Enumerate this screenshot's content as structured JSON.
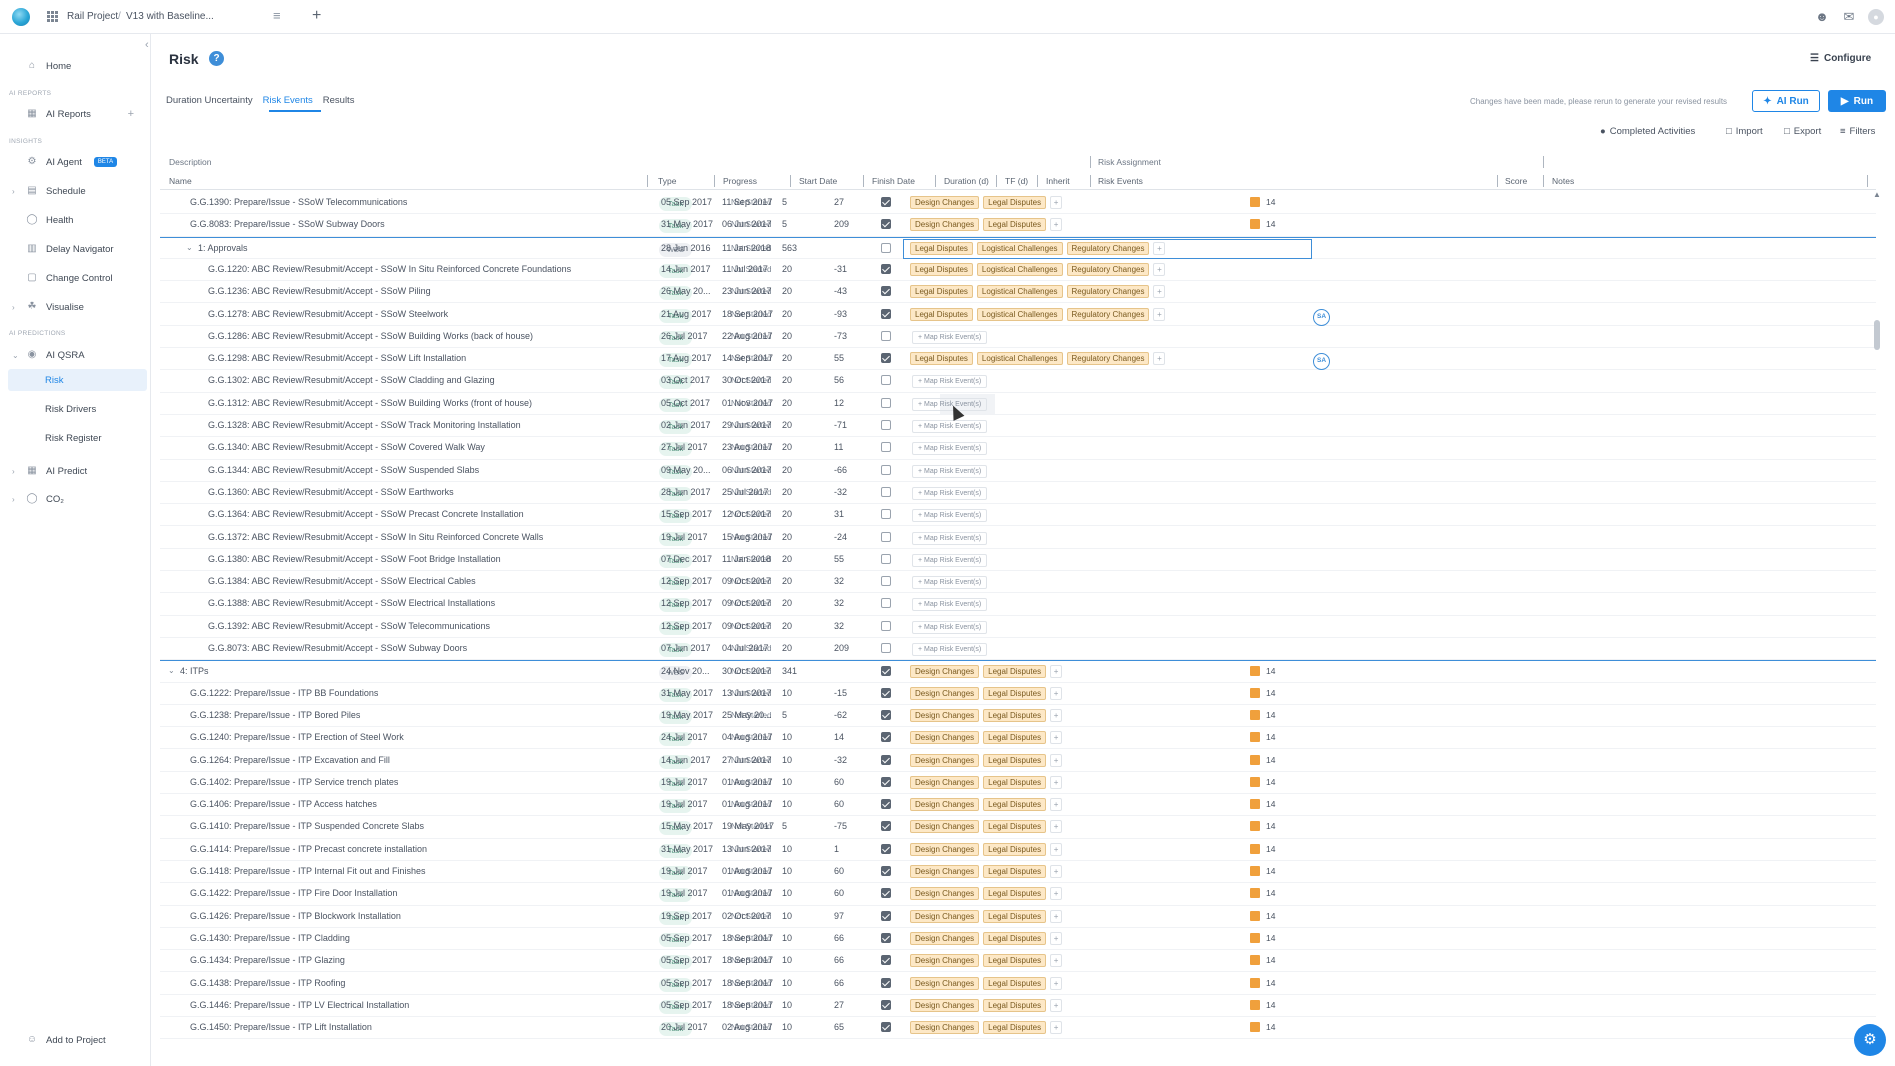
{
  "topbar": {
    "project": "Rail Project",
    "separator": "/",
    "version": "V13 with Baseline...",
    "menu_icon": "≡",
    "add_tab": "+"
  },
  "sidebar": {
    "home": "Home",
    "sec_reports": "AI REPORTS",
    "ai_reports": "AI Reports",
    "sec_insights": "INSIGHTS",
    "ai_agent": "AI Agent",
    "beta": "BETA",
    "schedule": "Schedule",
    "health": "Health",
    "delay_navigator": "Delay Navigator",
    "change_control": "Change Control",
    "visualise": "Visualise",
    "sec_predictions": "AI PREDICTIONS",
    "ai_qsra": "AI QSRA",
    "risk": "Risk",
    "risk_drivers": "Risk Drivers",
    "risk_register": "Risk Register",
    "ai_predict": "AI Predict",
    "co2": "CO₂",
    "add_to_project": "Add to Project"
  },
  "page": {
    "title": "Risk",
    "help": "?",
    "configure": "Configure",
    "tabs": [
      "Duration Uncertainty",
      "Risk Events",
      "Results"
    ],
    "notice": "Changes have been made, please rerun to generate your revised results",
    "ai_run": "AI Run",
    "run": "Run",
    "completed_activities": "Completed Activities",
    "import": "Import",
    "export": "Export",
    "filters": "Filters"
  },
  "grid": {
    "group_description": "Description",
    "group_risk": "Risk Assignment",
    "columns": [
      "Name",
      "Type",
      "Progress",
      "Start Date",
      "Finish Date",
      "Duration (d)",
      "TF (d)",
      "Inherit",
      "Risk Events",
      "Score",
      "Notes"
    ],
    "map_label": "+ Map Risk Event(s)",
    "avatar": "SA",
    "rows": [
      {
        "name": "G.G.1390: Prepare/Issue - SSoW Telecommunications",
        "type": "Task",
        "progress": "Not Started",
        "start": "05 Sep 2017",
        "finish": "11 Sep 2017",
        "dur": "5",
        "tf": "27",
        "inherit": true,
        "tags": [
          "Design Changes",
          "Legal Disputes"
        ],
        "score": "14",
        "indent": 1
      },
      {
        "name": "G.G.8083: Prepare/Issue - SSoW Subway Doors",
        "type": "Task",
        "progress": "Not Started",
        "start": "31 May 2017",
        "finish": "06 Jun 2017",
        "dur": "5",
        "tf": "209",
        "inherit": true,
        "tags": [
          "Design Changes",
          "Legal Disputes"
        ],
        "score": "14",
        "indent": 1
      },
      {
        "name": "1: Approvals",
        "type": "WBS",
        "progress": "Not Started",
        "start": "28 Jun 2016",
        "finish": "11 Jan 2018",
        "dur": "563",
        "tf": "",
        "inherit": false,
        "tags": [
          "Legal Disputes",
          "Logistical Challenges",
          "Regulatory Changes"
        ],
        "score": "",
        "indent": 2,
        "wbs": true,
        "selected": true
      },
      {
        "name": "G.G.1220: ABC Review/Resubmit/Accept - SSoW In Situ Reinforced Concrete Foundations",
        "type": "Task",
        "progress": "Not Started",
        "start": "14 Jun 2017",
        "finish": "11 Jul 2017",
        "dur": "20",
        "tf": "-31",
        "inherit": true,
        "tags": [
          "Legal Disputes",
          "Logistical Challenges",
          "Regulatory Changes"
        ],
        "score": "",
        "indent": 3
      },
      {
        "name": "G.G.1236: ABC Review/Resubmit/Accept - SSoW Piling",
        "type": "Task",
        "progress": "Not Started",
        "start": "26 May 20...",
        "finish": "23 Jun 2017",
        "dur": "20",
        "tf": "-43",
        "inherit": true,
        "tags": [
          "Legal Disputes",
          "Logistical Challenges",
          "Regulatory Changes"
        ],
        "score": "",
        "indent": 3
      },
      {
        "name": "G.G.1278: ABC Review/Resubmit/Accept - SSoW Steelwork",
        "type": "Task",
        "progress": "Not Started",
        "start": "21 Aug 2017",
        "finish": "18 Sep 2017",
        "dur": "20",
        "tf": "-93",
        "inherit": true,
        "tags": [
          "Legal Disputes",
          "Logistical Challenges",
          "Regulatory Changes"
        ],
        "score": "",
        "indent": 3,
        "avatar": true
      },
      {
        "name": "G.G.1286: ABC Review/Resubmit/Accept - SSoW Building Works (back of house)",
        "type": "Task",
        "progress": "Not Started",
        "start": "26 Jul 2017",
        "finish": "22 Aug 2017",
        "dur": "20",
        "tf": "-73",
        "inherit": false,
        "tags": [],
        "score": "",
        "indent": 3
      },
      {
        "name": "G.G.1298: ABC Review/Resubmit/Accept - SSoW Lift Installation",
        "type": "Task",
        "progress": "Not Started",
        "start": "17 Aug 2017",
        "finish": "14 Sep 2017",
        "dur": "20",
        "tf": "55",
        "inherit": true,
        "tags": [
          "Legal Disputes",
          "Logistical Challenges",
          "Regulatory Changes"
        ],
        "score": "",
        "indent": 3,
        "avatar": true
      },
      {
        "name": "G.G.1302: ABC Review/Resubmit/Accept - SSoW Cladding and Glazing",
        "type": "Task",
        "progress": "Not Started",
        "start": "03 Oct 2017",
        "finish": "30 Oct 2017",
        "dur": "20",
        "tf": "56",
        "inherit": false,
        "tags": [],
        "score": "",
        "indent": 3
      },
      {
        "name": "G.G.1312: ABC Review/Resubmit/Accept - SSoW Building Works (front of house)",
        "type": "Task",
        "progress": "Not Started",
        "start": "05 Oct 2017",
        "finish": "01 Nov 2017",
        "dur": "20",
        "tf": "12",
        "inherit": false,
        "tags": [],
        "score": "",
        "indent": 3
      },
      {
        "name": "G.G.1328: ABC Review/Resubmit/Accept - SSoW Track Monitoring Installation",
        "type": "Task",
        "progress": "Not Started",
        "start": "02 Jun 2017",
        "finish": "29 Jun 2017",
        "dur": "20",
        "tf": "-71",
        "inherit": false,
        "tags": [],
        "score": "",
        "indent": 3
      },
      {
        "name": "G.G.1340: ABC Review/Resubmit/Accept - SSoW Covered Walk Way",
        "type": "Task",
        "progress": "Not Started",
        "start": "27 Jul 2017",
        "finish": "23 Aug 2017",
        "dur": "20",
        "tf": "11",
        "inherit": false,
        "tags": [],
        "score": "",
        "indent": 3
      },
      {
        "name": "G.G.1344: ABC Review/Resubmit/Accept - SSoW Suspended Slabs",
        "type": "Task",
        "progress": "Not Started",
        "start": "09 May 20...",
        "finish": "06 Jun 2017",
        "dur": "20",
        "tf": "-66",
        "inherit": false,
        "tags": [],
        "score": "",
        "indent": 3
      },
      {
        "name": "G.G.1360: ABC Review/Resubmit/Accept - SSoW Earthworks",
        "type": "Task",
        "progress": "Not Started",
        "start": "28 Jun 2017",
        "finish": "25 Jul 2017",
        "dur": "20",
        "tf": "-32",
        "inherit": false,
        "tags": [],
        "score": "",
        "indent": 3
      },
      {
        "name": "G.G.1364: ABC Review/Resubmit/Accept - SSoW Precast Concrete Installation",
        "type": "Task",
        "progress": "Not Started",
        "start": "15 Sep 2017",
        "finish": "12 Oct 2017",
        "dur": "20",
        "tf": "31",
        "inherit": false,
        "tags": [],
        "score": "",
        "indent": 3
      },
      {
        "name": "G.G.1372: ABC Review/Resubmit/Accept - SSoW In Situ Reinforced Concrete Walls",
        "type": "Task",
        "progress": "Not Started",
        "start": "19 Jul 2017",
        "finish": "15 Aug 2017",
        "dur": "20",
        "tf": "-24",
        "inherit": false,
        "tags": [],
        "score": "",
        "indent": 3
      },
      {
        "name": "G.G.1380: ABC Review/Resubmit/Accept - SSoW Foot Bridge Installation",
        "type": "Task",
        "progress": "Not Started",
        "start": "07 Dec 2017",
        "finish": "11 Jan 2018",
        "dur": "20",
        "tf": "55",
        "inherit": false,
        "tags": [],
        "score": "",
        "indent": 3
      },
      {
        "name": "G.G.1384: ABC Review/Resubmit/Accept - SSoW Electrical Cables",
        "type": "Task",
        "progress": "Not Started",
        "start": "12 Sep 2017",
        "finish": "09 Oct 2017",
        "dur": "20",
        "tf": "32",
        "inherit": false,
        "tags": [],
        "score": "",
        "indent": 3
      },
      {
        "name": "G.G.1388: ABC Review/Resubmit/Accept - SSoW Electrical Installations",
        "type": "Task",
        "progress": "Not Started",
        "start": "12 Sep 2017",
        "finish": "09 Oct 2017",
        "dur": "20",
        "tf": "32",
        "inherit": false,
        "tags": [],
        "score": "",
        "indent": 3
      },
      {
        "name": "G.G.1392: ABC Review/Resubmit/Accept - SSoW Telecommunications",
        "type": "Task",
        "progress": "Not Started",
        "start": "12 Sep 2017",
        "finish": "09 Oct 2017",
        "dur": "20",
        "tf": "32",
        "inherit": false,
        "tags": [],
        "score": "",
        "indent": 3
      },
      {
        "name": "G.G.8073: ABC Review/Resubmit/Accept - SSoW Subway Doors",
        "type": "Task",
        "progress": "Not Started",
        "start": "07 Jun 2017",
        "finish": "04 Jul 2017",
        "dur": "20",
        "tf": "209",
        "inherit": false,
        "tags": [],
        "score": "",
        "indent": 3
      },
      {
        "name": "4: ITPs",
        "type": "WBS",
        "progress": "Not Started",
        "start": "24 Nov 20...",
        "finish": "30 Oct 2017",
        "dur": "341",
        "tf": "",
        "inherit": true,
        "tags": [
          "Design Changes",
          "Legal Disputes"
        ],
        "score": "14",
        "indent": 0,
        "wbs": true
      },
      {
        "name": "G.G.1222: Prepare/Issue - ITP BB Foundations",
        "type": "Task",
        "progress": "Not Started",
        "start": "31 May 2017",
        "finish": "13 Jun 2017",
        "dur": "10",
        "tf": "-15",
        "inherit": true,
        "tags": [
          "Design Changes",
          "Legal Disputes"
        ],
        "score": "14",
        "indent": 1
      },
      {
        "name": "G.G.1238: Prepare/Issue - ITP Bored Piles",
        "type": "Task",
        "progress": "Not Started",
        "start": "19 May 2017",
        "finish": "25 May 20...",
        "dur": "5",
        "tf": "-62",
        "inherit": true,
        "tags": [
          "Design Changes",
          "Legal Disputes"
        ],
        "score": "14",
        "indent": 1
      },
      {
        "name": "G.G.1240: Prepare/Issue - ITP Erection of Steel Work",
        "type": "Task",
        "progress": "Not Started",
        "start": "24 Jul 2017",
        "finish": "04 Aug 2017",
        "dur": "10",
        "tf": "14",
        "inherit": true,
        "tags": [
          "Design Changes",
          "Legal Disputes"
        ],
        "score": "14",
        "indent": 1
      },
      {
        "name": "G.G.1264: Prepare/Issue - ITP Excavation and Fill",
        "type": "Task",
        "progress": "Not Started",
        "start": "14 Jun 2017",
        "finish": "27 Jun 2017",
        "dur": "10",
        "tf": "-32",
        "inherit": true,
        "tags": [
          "Design Changes",
          "Legal Disputes"
        ],
        "score": "14",
        "indent": 1
      },
      {
        "name": "G.G.1402: Prepare/Issue - ITP Service trench plates",
        "type": "Task",
        "progress": "Not Started",
        "start": "19 Jul 2017",
        "finish": "01 Aug 2017",
        "dur": "10",
        "tf": "60",
        "inherit": true,
        "tags": [
          "Design Changes",
          "Legal Disputes"
        ],
        "score": "14",
        "indent": 1
      },
      {
        "name": "G.G.1406: Prepare/Issue - ITP Access hatches",
        "type": "Task",
        "progress": "Not Started",
        "start": "19 Jul 2017",
        "finish": "01 Aug 2017",
        "dur": "10",
        "tf": "60",
        "inherit": true,
        "tags": [
          "Design Changes",
          "Legal Disputes"
        ],
        "score": "14",
        "indent": 1
      },
      {
        "name": "G.G.1410: Prepare/Issue - ITP Suspended Concrete Slabs",
        "type": "Task",
        "progress": "Not Started",
        "start": "15 May 2017",
        "finish": "19 May 2017",
        "dur": "5",
        "tf": "-75",
        "inherit": true,
        "tags": [
          "Design Changes",
          "Legal Disputes"
        ],
        "score": "14",
        "indent": 1
      },
      {
        "name": "G.G.1414: Prepare/Issue - ITP Precast concrete installation",
        "type": "Task",
        "progress": "Not Started",
        "start": "31 May 2017",
        "finish": "13 Jun 2017",
        "dur": "10",
        "tf": "1",
        "inherit": true,
        "tags": [
          "Design Changes",
          "Legal Disputes"
        ],
        "score": "14",
        "indent": 1
      },
      {
        "name": "G.G.1418: Prepare/Issue - ITP Internal Fit out and Finishes",
        "type": "Task",
        "progress": "Not Started",
        "start": "19 Jul 2017",
        "finish": "01 Aug 2017",
        "dur": "10",
        "tf": "60",
        "inherit": true,
        "tags": [
          "Design Changes",
          "Legal Disputes"
        ],
        "score": "14",
        "indent": 1
      },
      {
        "name": "G.G.1422: Prepare/Issue - ITP Fire Door Installation",
        "type": "Task",
        "progress": "Not Started",
        "start": "19 Jul 2017",
        "finish": "01 Aug 2017",
        "dur": "10",
        "tf": "60",
        "inherit": true,
        "tags": [
          "Design Changes",
          "Legal Disputes"
        ],
        "score": "14",
        "indent": 1
      },
      {
        "name": "G.G.1426: Prepare/Issue - ITP Blockwork Installation",
        "type": "Task",
        "progress": "Not Started",
        "start": "19 Sep 2017",
        "finish": "02 Oct 2017",
        "dur": "10",
        "tf": "97",
        "inherit": true,
        "tags": [
          "Design Changes",
          "Legal Disputes"
        ],
        "score": "14",
        "indent": 1
      },
      {
        "name": "G.G.1430: Prepare/Issue - ITP Cladding",
        "type": "Task",
        "progress": "Not Started",
        "start": "05 Sep 2017",
        "finish": "18 Sep 2017",
        "dur": "10",
        "tf": "66",
        "inherit": true,
        "tags": [
          "Design Changes",
          "Legal Disputes"
        ],
        "score": "14",
        "indent": 1
      },
      {
        "name": "G.G.1434: Prepare/Issue - ITP Glazing",
        "type": "Task",
        "progress": "Not Started",
        "start": "05 Sep 2017",
        "finish": "18 Sep 2017",
        "dur": "10",
        "tf": "66",
        "inherit": true,
        "tags": [
          "Design Changes",
          "Legal Disputes"
        ],
        "score": "14",
        "indent": 1
      },
      {
        "name": "G.G.1438: Prepare/Issue - ITP Roofing",
        "type": "Task",
        "progress": "Not Started",
        "start": "05 Sep 2017",
        "finish": "18 Sep 2017",
        "dur": "10",
        "tf": "66",
        "inherit": true,
        "tags": [
          "Design Changes",
          "Legal Disputes"
        ],
        "score": "14",
        "indent": 1
      },
      {
        "name": "G.G.1446: Prepare/Issue - ITP LV Electrical Installation",
        "type": "Task",
        "progress": "Not Started",
        "start": "05 Sep 2017",
        "finish": "18 Sep 2017",
        "dur": "10",
        "tf": "27",
        "inherit": true,
        "tags": [
          "Design Changes",
          "Legal Disputes"
        ],
        "score": "14",
        "indent": 1
      },
      {
        "name": "G.G.1450: Prepare/Issue - ITP Lift Installation",
        "type": "Task",
        "progress": "Not Started",
        "start": "20 Jul 2017",
        "finish": "02 Aug 2017",
        "dur": "10",
        "tf": "65",
        "inherit": true,
        "tags": [
          "Design Changes",
          "Legal Disputes"
        ],
        "score": "14",
        "indent": 1
      }
    ]
  },
  "colors": {
    "accent": "#1f86e6",
    "tag_fill": "#fde8c6",
    "score": "#f0a03c",
    "task_pill": "#e6f4ef"
  }
}
